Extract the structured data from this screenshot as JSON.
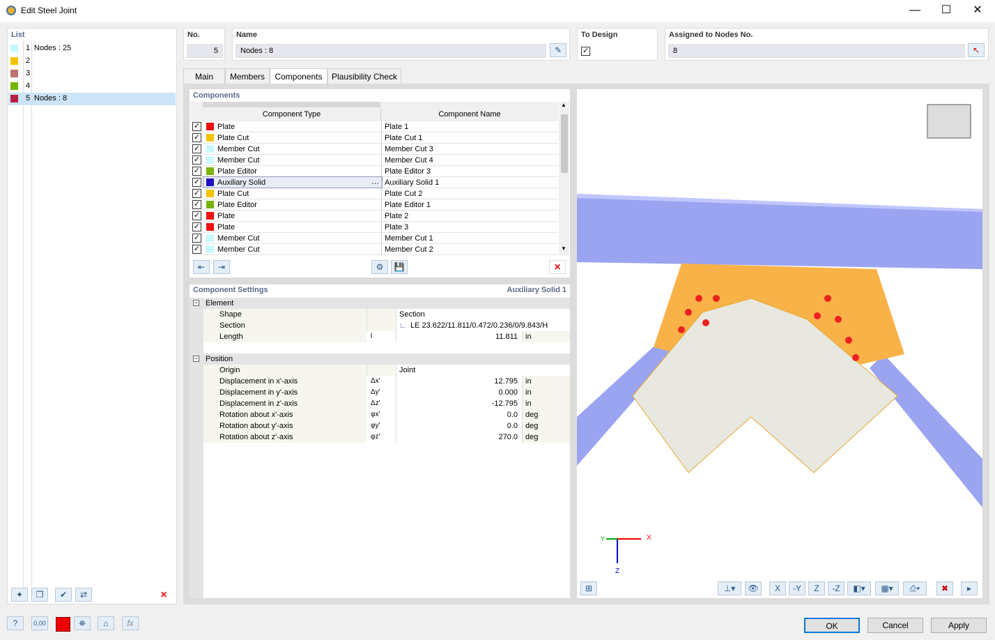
{
  "window": {
    "title": "Edit Steel Joint",
    "minimize": "—",
    "maximize": "☐",
    "close": "✕"
  },
  "list": {
    "header": "List",
    "items": [
      {
        "no": "1",
        "label": "Nodes : 25",
        "color": "#c8f8ff"
      },
      {
        "no": "2",
        "label": "",
        "color": "#f5c400"
      },
      {
        "no": "3",
        "label": "",
        "color": "#c07070"
      },
      {
        "no": "4",
        "label": "",
        "color": "#78b400"
      },
      {
        "no": "5",
        "label": "Nodes : 8",
        "color": "#b82040",
        "selected": true
      }
    ]
  },
  "fields": {
    "no_label": "No.",
    "no_value": "5",
    "name_label": "Name",
    "name_value": "Nodes : 8",
    "to_design_label": "To Design",
    "to_design_checked": true,
    "assigned_label": "Assigned to Nodes No.",
    "assigned_value": "8"
  },
  "tabs": [
    {
      "label": "Main"
    },
    {
      "label": "Members"
    },
    {
      "label": "Components",
      "active": true
    },
    {
      "label": "Plausibility Check"
    }
  ],
  "components": {
    "header": "Components",
    "col_type": "Component Type",
    "col_name": "Component Name",
    "rows": [
      {
        "type": "Plate",
        "name": "Plate 1",
        "color": "#ee1010"
      },
      {
        "type": "Plate Cut",
        "name": "Plate Cut 1",
        "color": "#f5c400"
      },
      {
        "type": "Member Cut",
        "name": "Member Cut 3",
        "color": "#c8f8ff"
      },
      {
        "type": "Member Cut",
        "name": "Member Cut 4",
        "color": "#c8f8ff"
      },
      {
        "type": "Plate Editor",
        "name": "Plate Editor 3",
        "color": "#78b400"
      },
      {
        "type": "Auxiliary Solid",
        "name": "Auxiliary Solid 1",
        "color": "#2010c0",
        "selected": true
      },
      {
        "type": "Plate Cut",
        "name": "Plate Cut 2",
        "color": "#f5c400"
      },
      {
        "type": "Plate Editor",
        "name": "Plate Editor 1",
        "color": "#78b400"
      },
      {
        "type": "Plate",
        "name": "Plate 2",
        "color": "#ee1010"
      },
      {
        "type": "Plate",
        "name": "Plate 3",
        "color": "#ee1010"
      },
      {
        "type": "Member Cut",
        "name": "Member Cut 1",
        "color": "#c8f8ff"
      },
      {
        "type": "Member Cut",
        "name": "Member Cut 2",
        "color": "#c8f8ff"
      }
    ]
  },
  "settings": {
    "header": "Component Settings",
    "current": "Auxiliary Solid 1",
    "groups": [
      {
        "label": "Element",
        "rows": [
          {
            "label": "Shape",
            "sym": "",
            "value": "Section",
            "unit": "",
            "align": "left"
          },
          {
            "label": "Section",
            "sym": "",
            "value": "LE 23.622/11.811/0.472/0.236/0/9.843/H",
            "unit": "",
            "align": "left",
            "icon": true
          },
          {
            "label": "Length",
            "sym": "l",
            "value": "11.811",
            "unit": "in"
          }
        ]
      },
      {
        "label": "Position",
        "rows": [
          {
            "label": "Origin",
            "sym": "",
            "value": "Joint",
            "unit": "",
            "align": "left"
          },
          {
            "label": "Displacement in x'-axis",
            "sym": "Δx'",
            "value": "12.795",
            "unit": "in"
          },
          {
            "label": "Displacement in y'-axis",
            "sym": "Δy'",
            "value": "0.000",
            "unit": "in"
          },
          {
            "label": "Displacement in z'-axis",
            "sym": "Δz'",
            "value": "-12.795",
            "unit": "in"
          },
          {
            "label": "Rotation about x'-axis",
            "sym": "φx'",
            "value": "0.0",
            "unit": "deg"
          },
          {
            "label": "Rotation about y'-axis",
            "sym": "φy'",
            "value": "0.0",
            "unit": "deg"
          },
          {
            "label": "Rotation about z'-axis",
            "sym": "φz'",
            "value": "270.0",
            "unit": "deg"
          }
        ]
      }
    ]
  },
  "viewport": {
    "axis_x": "X",
    "axis_y": "Y",
    "axis_z": "Z"
  },
  "footer": {
    "ok": "OK",
    "cancel": "Cancel",
    "apply": "Apply",
    "units_icon": "0,00"
  }
}
